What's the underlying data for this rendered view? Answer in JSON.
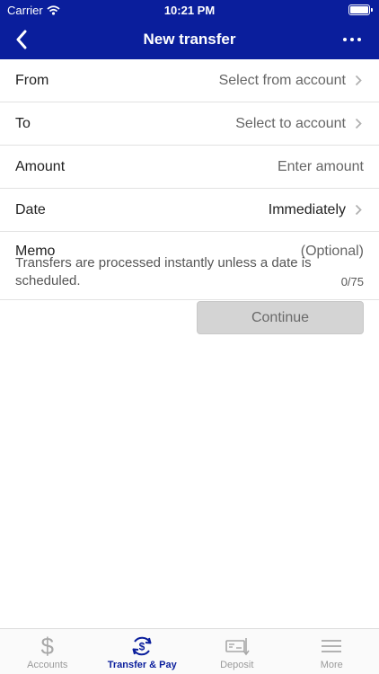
{
  "status_bar": {
    "carrier": "Carrier",
    "time": "10:21 PM"
  },
  "nav": {
    "title": "New transfer",
    "back_icon": "chevron-left-icon",
    "menu_icon": "more-dots-icon"
  },
  "form": {
    "from": {
      "label": "From",
      "value": "Select from account"
    },
    "to": {
      "label": "To",
      "value": "Select to account"
    },
    "amount": {
      "label": "Amount",
      "placeholder": "Enter amount"
    },
    "date": {
      "label": "Date",
      "value": "Immediately"
    },
    "memo": {
      "label": "Memo",
      "placeholder": "(Optional)",
      "counter": "0/75"
    }
  },
  "info_text": "Transfers are processed instantly unless a date is scheduled.",
  "continue_label": "Continue",
  "tabs": [
    {
      "label": "Accounts",
      "icon": "dollar-icon",
      "active": false
    },
    {
      "label": "Transfer & Pay",
      "icon": "transfer-pay-icon",
      "active": true
    },
    {
      "label": "Deposit",
      "icon": "deposit-check-icon",
      "active": false
    },
    {
      "label": "More",
      "icon": "menu-icon",
      "active": false
    }
  ],
  "colors": {
    "brand": "#0a1e9c",
    "button_disabled": "#d4d4d4",
    "tab_inactive": "#9a9a9a"
  }
}
